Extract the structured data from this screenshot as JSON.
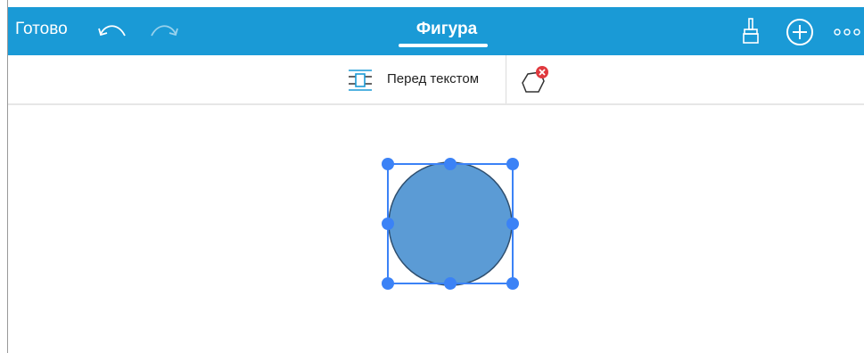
{
  "header": {
    "done_label": "Готово",
    "title": "Фигура",
    "icons": [
      "undo-icon",
      "redo-icon",
      "brush-icon",
      "add-icon",
      "more-icon"
    ]
  },
  "toolbar": {
    "wrap_label": "Перед текстом",
    "icons": [
      "wrap-in-front-icon",
      "shape-delete-icon"
    ]
  },
  "canvas": {
    "shape_type": "circle",
    "selected": true
  },
  "colors": {
    "accent": "#1a9ad6",
    "shape_fill": "#5b9bd5",
    "shape_stroke": "#2f4f6f",
    "selection": "#3b82f6",
    "delete_badge": "#e0393e"
  }
}
